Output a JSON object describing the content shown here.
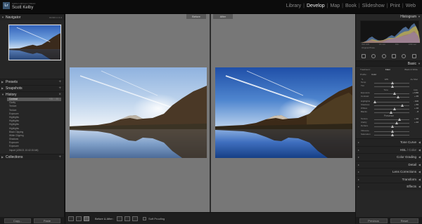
{
  "app": {
    "logo": "Lr",
    "catalog": "Adobe Lightroom Classic",
    "identity": "Scott Kelby"
  },
  "modules": [
    "Library",
    "Develop",
    "Map",
    "Book",
    "Slideshow",
    "Print",
    "Web"
  ],
  "active_module": "Develop",
  "left_panel": {
    "navigator": {
      "title": "Navigator",
      "zoom": "Fit  Fill  1:1  1:4"
    },
    "presets": {
      "title": "Presets"
    },
    "snapshots": {
      "title": "Snapshots"
    },
    "history": {
      "title": "History",
      "items": [
        {
          "label": "Contrast",
          "v1": "+35",
          "v2": "35",
          "selected": true
        },
        {
          "label": "Clarity",
          "v1": "",
          "v2": ""
        },
        {
          "label": "Texture",
          "v1": "",
          "v2": ""
        },
        {
          "label": "Texture",
          "v1": "",
          "v2": ""
        },
        {
          "label": "Exposure",
          "v1": "",
          "v2": ""
        },
        {
          "label": "Highlights",
          "v1": "",
          "v2": ""
        },
        {
          "label": "Highlights",
          "v1": "",
          "v2": ""
        },
        {
          "label": "Highlights",
          "v1": "",
          "v2": ""
        },
        {
          "label": "Highlights",
          "v1": "",
          "v2": ""
        },
        {
          "label": "Black Clipping",
          "v1": "",
          "v2": ""
        },
        {
          "label": "White Clipping",
          "v1": "",
          "v2": ""
        },
        {
          "label": "Shadows",
          "v1": "",
          "v2": ""
        },
        {
          "label": "Exposure",
          "v1": "",
          "v2": ""
        },
        {
          "label": "Exposure",
          "v1": "",
          "v2": ""
        },
        {
          "label": "Import (4/30/21 10:42:15 AM)",
          "v1": "",
          "v2": ""
        }
      ]
    },
    "collections": {
      "title": "Collections"
    },
    "buttons": {
      "copy": "Copy...",
      "paste": "Paste"
    }
  },
  "view": {
    "before_label": "Before",
    "after_label": "After"
  },
  "toolbar": {
    "before_after": "Before & After :",
    "soft_proofing": "Soft Proofing"
  },
  "right_panel": {
    "histogram": {
      "title": "Histogram",
      "info_left": "ISO 100",
      "info_mid": "16 mm",
      "info_right": "f/11",
      "info_far": "1/80 sec",
      "original": "Original Photo"
    },
    "basic": {
      "title": "Basic",
      "treatment_label": "Treatment :",
      "treatment_color": "Color",
      "treatment_bw": "Black & White",
      "profile_label": "Profile :",
      "profile_value": "Color",
      "wb_label": "WB :",
      "wb_value": "As Shot",
      "temp_label": "Temp",
      "tint_label": "Tint",
      "tone_label": "Tone",
      "tone_auto": "Auto",
      "exposure_label": "Exposure",
      "exposure_value": "+ 0.80",
      "contrast_label": "Contrast",
      "contrast_value": "+ 35",
      "highlights_label": "Highlights",
      "highlights_value": "- 100",
      "shadows_label": "Shadows",
      "shadows_value": "+ 55",
      "whites_label": "Whites",
      "whites_value": "+ 10",
      "blacks_label": "Blacks",
      "blacks_value": "- 8",
      "presence_label": "Presence",
      "texture_label": "Texture",
      "texture_value": "+ 40",
      "clarity_label": "Clarity",
      "clarity_value": "+ 22",
      "dehaze_label": "Dehaze",
      "dehaze_value": "0",
      "vibrance_label": "Vibrance",
      "vibrance_value": "0",
      "saturation_label": "Saturation",
      "saturation_value": "0"
    },
    "panels": [
      {
        "label": "Tone Curve",
        "suffix": ""
      },
      {
        "label": "HSL",
        "suffix": " / Color"
      },
      {
        "label": "Color Grading",
        "suffix": ""
      },
      {
        "label": "Detail",
        "suffix": ""
      },
      {
        "label": "Lens Corrections",
        "suffix": ""
      },
      {
        "label": "Transform",
        "suffix": ""
      },
      {
        "label": "Effects",
        "suffix": ""
      }
    ],
    "buttons": {
      "previous": "Previous",
      "reset": "Reset"
    }
  },
  "colors": {
    "accent": "#f0f0f0",
    "panel": "#262626",
    "canvas": "#777777"
  }
}
